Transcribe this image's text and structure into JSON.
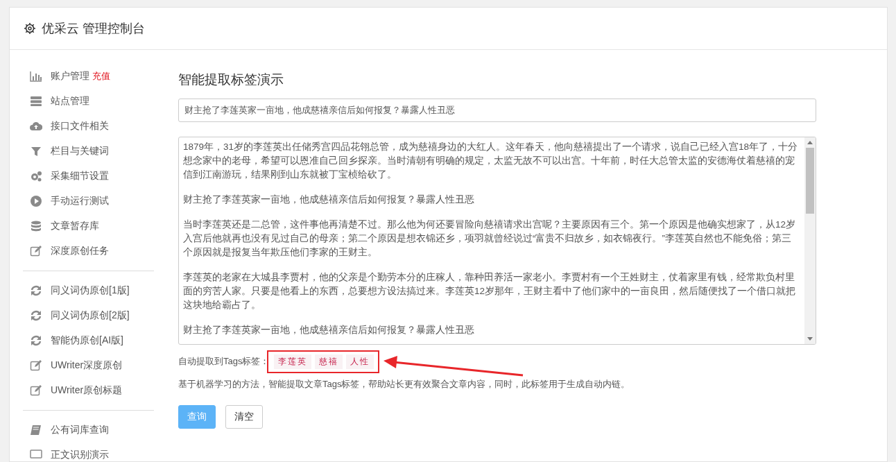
{
  "header": {
    "title": "优采云 管理控制台"
  },
  "sidebar": {
    "groups": [
      {
        "items": [
          {
            "label": "账户管理",
            "badge": "充值"
          },
          {
            "label": "站点管理"
          },
          {
            "label": "接口文件相关"
          },
          {
            "label": "栏目与关键词"
          },
          {
            "label": "采集细节设置"
          },
          {
            "label": "手动运行测试"
          },
          {
            "label": "文章暂存库"
          },
          {
            "label": "深度原创任务"
          }
        ]
      },
      {
        "items": [
          {
            "label": "同义词伪原创[1版]"
          },
          {
            "label": "同义词伪原创[2版]"
          },
          {
            "label": "智能伪原创[AI版]"
          },
          {
            "label": "UWriter深度原创"
          },
          {
            "label": "UWriter原创标题"
          }
        ]
      },
      {
        "items": [
          {
            "label": "公有词库查询"
          },
          {
            "label": "正文识别演示"
          }
        ]
      }
    ]
  },
  "main": {
    "heading": "智能提取标签演示",
    "title_field": {
      "value": "财主抢了李莲英家一亩地，他成慈禧亲信后如何报复？暴露人性丑恶"
    },
    "article_field": {
      "paragraphs": [
        "1879年，31岁的李莲英出任储秀宫四品花翎总管，成为慈禧身边的大红人。这年春天，他向慈禧提出了一个请求，说自己已经入宫18年了，十分想念家中的老母，希望可以恩准自己回乡探亲。当时清朝有明确的规定，太监无故不可以出宫。十年前，时任大总管太监的安德海仗着慈禧的宠信到江南游玩，结果刚到山东就被丁宝桢给砍了。",
        "财主抢了李莲英家一亩地，他成慈禧亲信后如何报复？暴露人性丑恶",
        "当时李莲英还是二总管，这件事他再清楚不过。那么他为何还要冒险向慈禧请求出宫呢？主要原因有三个。第一个原因是他确实想家了，从12岁入宫后他就再也没有见过自己的母亲；第二个原因是想衣锦还乡，项羽就曾经说过“富贵不归故乡，如衣锦夜行。”李莲英自然也不能免俗；第三个原因就是报复当年欺压他们李家的王财主。",
        "李莲英的老家在大城县李贾村，他的父亲是个勤劳本分的庄稼人，靠种田养活一家老小。李贾村有一个王姓财主，仗着家里有钱，经常欺负村里面的穷苦人家。只要是他看上的东西，总要想方设法搞过来。李莲英12岁那年，王财主看中了他们家中的一亩良田，然后随便找了一个借口就把这块地给霸占了。",
        "财主抢了李莲英家一亩地，他成慈禧亲信后如何报复？暴露人性丑恶"
      ]
    },
    "tags_label": "自动提取到Tags标签：",
    "tags": [
      "李莲英",
      "慈禧",
      "人性"
    ],
    "description": "基于机器学习的方法，智能提取文章Tags标签，帮助站长更有效聚合文章内容，同时，此标签用于生成自动内链。",
    "buttons": [
      {
        "label": "查询",
        "kind": "primary"
      },
      {
        "label": "清空",
        "kind": "default"
      }
    ]
  }
}
